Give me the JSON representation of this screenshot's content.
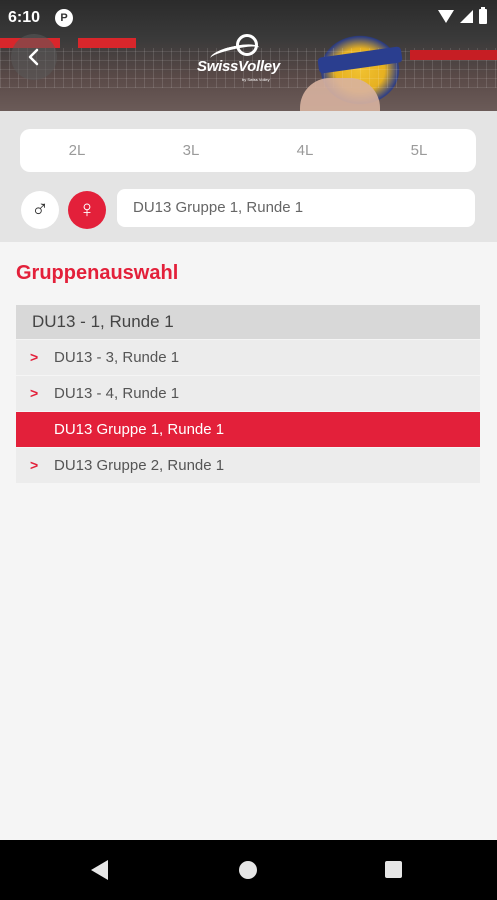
{
  "status_bar": {
    "time": "6:10",
    "notification_icon": "play-services-icon",
    "icons": [
      "wifi-icon",
      "signal-icon",
      "battery-icon"
    ]
  },
  "header": {
    "back_icon": "back-arrow-icon",
    "logo_text": "SwissVolley",
    "logo_subtext": "by Swiss Volley"
  },
  "filters": {
    "league_tabs": [
      "2L",
      "3L",
      "4L",
      "5L"
    ],
    "gender_male_symbol": "♂",
    "gender_female_symbol": "♀",
    "selected_gender": "female",
    "group_value": "DU13 Gruppe 1, Runde 1"
  },
  "main": {
    "section_title": "Gruppenauswahl",
    "current_group": "DU13 - 1, Runde 1",
    "groups": [
      {
        "label": "DU13 - 3, Runde 1",
        "active": false
      },
      {
        "label": "DU13 - 4, Runde 1",
        "active": false
      },
      {
        "label": "DU13 Gruppe 1, Runde 1",
        "active": true
      },
      {
        "label": "DU13 Gruppe 2, Runde 1",
        "active": false
      }
    ]
  },
  "colors": {
    "accent": "#e3203a",
    "filter_bg": "#e4e4e4",
    "content_bg": "#f5f5f5"
  },
  "nav_bar": {
    "icons": [
      "nav-back-icon",
      "nav-home-icon",
      "nav-recents-icon"
    ]
  }
}
